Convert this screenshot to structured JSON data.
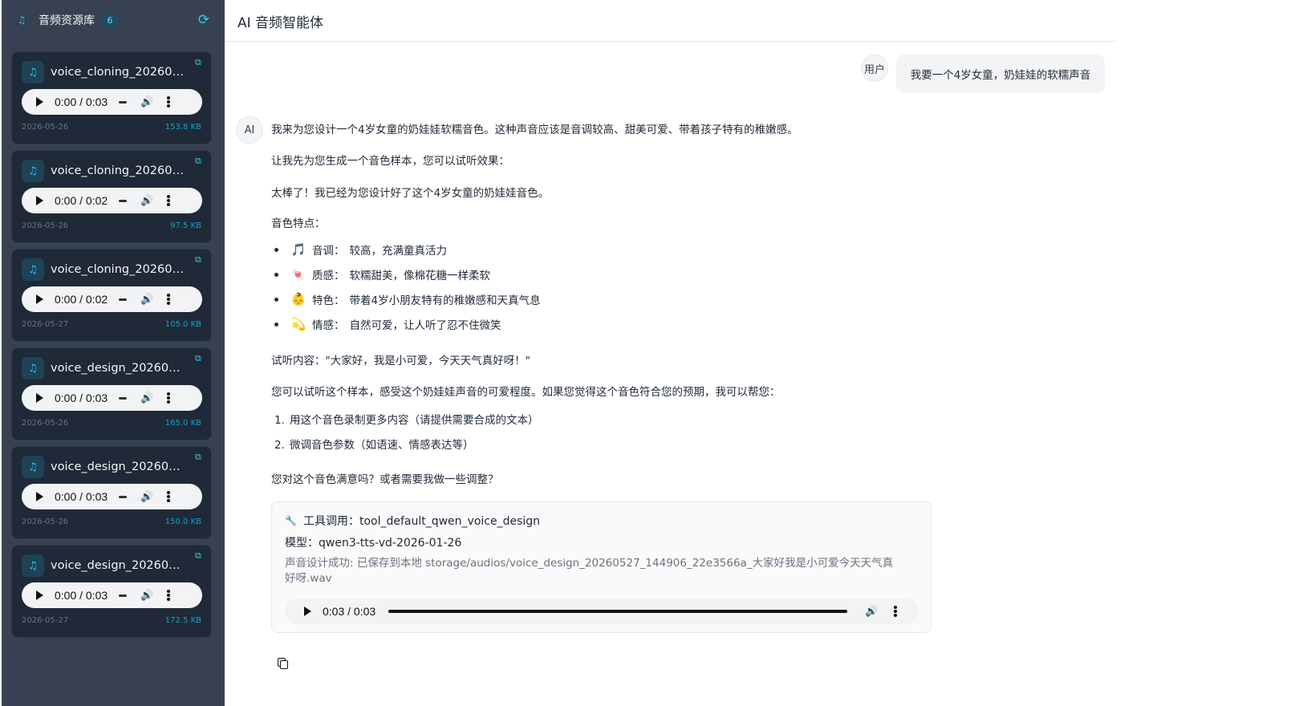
{
  "sidebar": {
    "title": "音频资源库",
    "count": "6",
    "logo_icon": "music-note-icon",
    "refresh_icon": "refresh-icon",
    "files": [
      {
        "name": "voice_cloning_2026052...",
        "time": "0:00 / 0:03",
        "date": "2026-05-26",
        "size": "153.8 KB"
      },
      {
        "name": "voice_cloning_2026052...",
        "time": "0:00 / 0:02",
        "date": "2026-05-26",
        "size": "97.5 KB"
      },
      {
        "name": "voice_cloning_2026052...",
        "time": "0:00 / 0:02",
        "date": "2026-05-27",
        "size": "105.0 KB"
      },
      {
        "name": "voice_design_2026052...",
        "time": "0:00 / 0:03",
        "date": "2026-05-26",
        "size": "165.0 KB"
      },
      {
        "name": "voice_design_2026052...",
        "time": "0:00 / 0:03",
        "date": "2026-05-26",
        "size": "150.0 KB"
      },
      {
        "name": "voice_design_2026052...",
        "time": "0:00 / 0:03",
        "date": "2026-05-27",
        "size": "172.5 KB"
      }
    ]
  },
  "main": {
    "title": "AI 音频智能体"
  },
  "chat": {
    "user_label": "用户",
    "user_message": "我要一个4岁女童，奶娃娃的软糯声音",
    "ai_label": "AI",
    "p1": "我来为您设计一个4岁女童的奶娃娃软糯音色。这种声音应该是音调较高、甜美可爱、带着孩子特有的稚嫩感。",
    "p2": "让我先为您生成一个音色样本，您可以试听效果：",
    "p3": "太棒了！我已经为您设计好了这个4岁女童的奶娃娃音色。",
    "features_title": "音色特点：",
    "features": [
      {
        "emoji": "🎵",
        "key": "音调：",
        "value": "较高，充满童真活力"
      },
      {
        "emoji": "🍬",
        "key": "质感：",
        "value": "软糯甜美，像棉花糖一样柔软"
      },
      {
        "emoji": "👶",
        "key": "特色：",
        "value": "带着4岁小朋友特有的稚嫩感和天真气息"
      },
      {
        "emoji": "💫",
        "key": "情感：",
        "value": "自然可爱，让人听了忍不住微笑"
      }
    ],
    "sample": "试听内容：\"大家好，我是小可爱，今天天气真好呀！\"",
    "p4": "您可以试听这个样本，感受这个奶娃娃声音的可爱程度。如果您觉得这个音色符合您的预期，我可以帮您：",
    "options": [
      {
        "num": "1.",
        "text": "用这个音色录制更多内容（请提供需要合成的文本）"
      },
      {
        "num": "2.",
        "text": "微调音色参数（如语速、情感表达等）"
      }
    ],
    "p5": "您对这个音色满意吗？或者需要我做一些调整？"
  },
  "tool": {
    "call_label": "工具调用：tool_default_qwen_voice_design",
    "model_label": "模型：qwen3-tts-vd-2026-01-26",
    "result": "声音设计成功: 已保存到本地 storage/audios/voice_design_20260527_144906_22e3566a_大家好我是小可爱今天天气真好呀.wav",
    "player_time": "0:03 / 0:03",
    "progress": 1.0
  }
}
